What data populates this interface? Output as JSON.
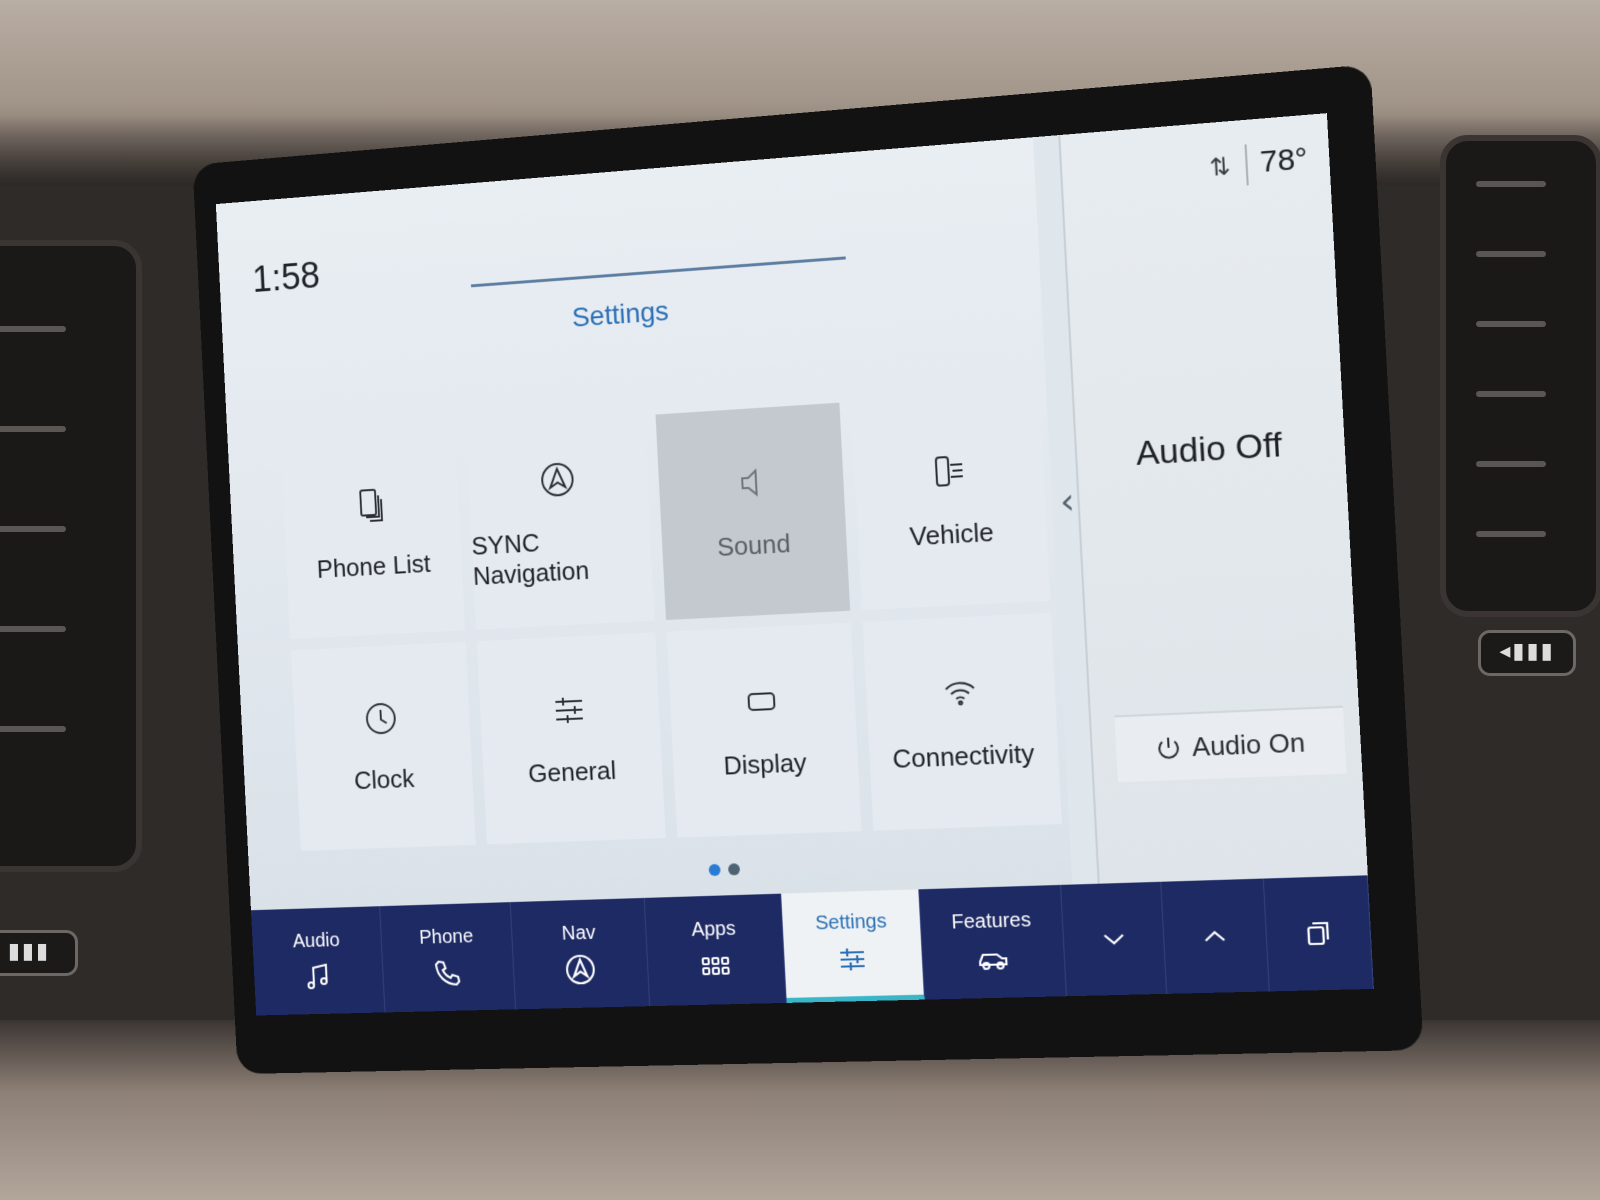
{
  "status": {
    "time": "1:58",
    "temperature": "78°",
    "signal_icon": "signal-arrows-icon"
  },
  "settings": {
    "title": "Settings",
    "tiles": [
      {
        "label": "Phone List",
        "icon": "phone-list-icon",
        "active": false
      },
      {
        "label": "SYNC Navigation",
        "icon": "navigation-icon",
        "active": false
      },
      {
        "label": "Sound",
        "icon": "speaker-icon",
        "active": true
      },
      {
        "label": "Vehicle",
        "icon": "vehicle-settings-icon",
        "active": false
      },
      {
        "label": "Clock",
        "icon": "clock-icon",
        "active": false
      },
      {
        "label": "General",
        "icon": "sliders-icon",
        "active": false
      },
      {
        "label": "Display",
        "icon": "display-icon",
        "active": false
      },
      {
        "label": "Connectivity",
        "icon": "wifi-icon",
        "active": false
      }
    ],
    "page_count": 2,
    "current_page": 1
  },
  "side_panel": {
    "audio_status": "Audio Off",
    "audio_on_label": "Audio On"
  },
  "nav": {
    "items": [
      {
        "label": "Audio",
        "icon": "music-note-icon"
      },
      {
        "label": "Phone",
        "icon": "phone-icon"
      },
      {
        "label": "Nav",
        "icon": "navigation-icon"
      },
      {
        "label": "Apps",
        "icon": "apps-grid-icon"
      },
      {
        "label": "Settings",
        "icon": "sliders-icon",
        "active": true
      },
      {
        "label": "Features",
        "icon": "vehicle-icon"
      }
    ],
    "controls": [
      "chevron-down-icon",
      "chevron-up-icon",
      "copy-pages-icon"
    ]
  },
  "colors": {
    "accent_blue": "#2a6fb5",
    "nav_bar": "#1e2a63",
    "active_underline": "#3ab6c8"
  }
}
